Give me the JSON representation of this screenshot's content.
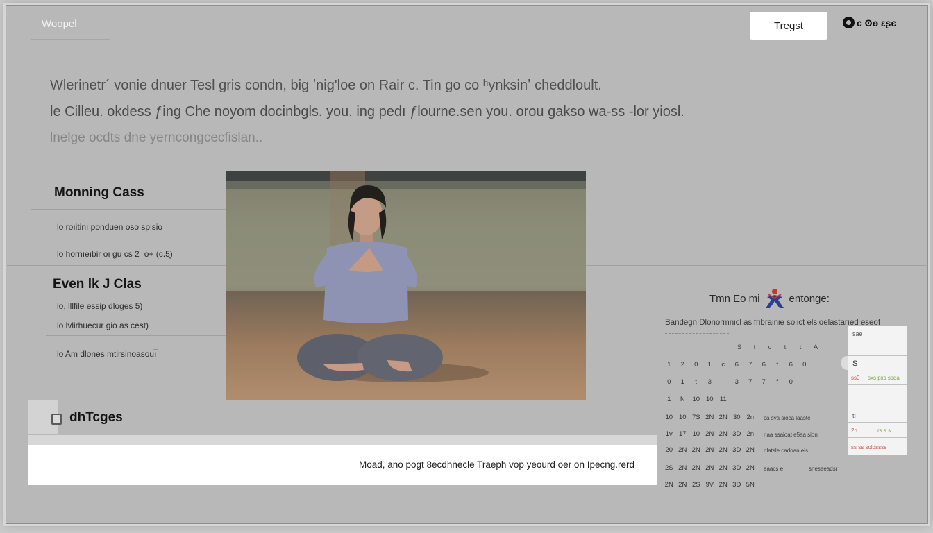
{
  "header": {
    "logo": "Woopel",
    "button_label": "Tregst",
    "account_label": "c ʘѳ εʂє"
  },
  "intro": {
    "lines": [
      "Wlerinetr´ vonie dnuer Tesl gris condn, big ʼnig'loe  on  Rair c.  Tin  go co  ʰynksinʼ  cheddloult.",
      "le Cilleu. okdess ƒing  Che noyom docinbgls. you. ing pedı ƒlourne.sen you.  orou  gakso  wa-ss  -lor yiosl.",
      "lnelge  ocdts  dne  yerncongcecfislan.."
    ]
  },
  "morning": {
    "title": "Monning Cass",
    "items": [
      "lo   roıitinı ponduen oso splsio",
      "lo   hornıeıbir  oı gu cs  2=o+ (c.5̩)"
    ]
  },
  "evening": {
    "title": "Even lk J Clas",
    "items": [
      "lo, lllfile  essip  dloges  5)",
      "lo   lvlirhuecur  gio  as  cest)",
      "lo   Am dlones  mtirsinoasouı̅"
    ]
  },
  "photo": {
    "subject": "person in meditation squat on studio floor"
  },
  "docs": {
    "title": "dhTcges",
    "text": "Moad, ano pogt 8ecdhnecle  Traeph vop yeourd oer on Ipecng.rerd"
  },
  "calendar": {
    "header_pre": "Tmn Eo mi",
    "header_post": "entonge:",
    "logo_icon": "figure-icon",
    "subtitle": "Bandegn Dlonormnicl asifribrainie solict elsioelastarıed eseof",
    "weekdays": [
      "S",
      "t",
      "c",
      "t",
      "t",
      "A"
    ],
    "rows": [
      [
        "1",
        "2",
        "0",
        "1",
        "c",
        "6",
        "7",
        "6",
        "f",
        "6",
        "0",
        "",
        ""
      ],
      [
        "0",
        "1",
        "t",
        "3",
        "",
        "3",
        "7",
        "7",
        "f",
        "0",
        "",
        "",
        ""
      ],
      [
        "1",
        "N",
        "10",
        "10",
        "11",
        "",
        "",
        "",
        "",
        "",
        "",
        "",
        ""
      ],
      [
        "10",
        "10",
        "7S",
        "2N",
        "2N",
        "30",
        "2n",
        "",
        "",
        "",
        "",
        "",
        ""
      ],
      [
        "1v",
        "17",
        "10",
        "2N",
        "2N",
        "3D",
        "2n",
        "",
        "",
        "",
        "",
        "",
        ""
      ],
      [
        "20",
        "2N",
        "2N",
        "2N",
        "2N",
        "3D",
        "2N",
        "",
        "",
        "",
        "",
        "",
        ""
      ],
      [
        "2S",
        "2N",
        "2N",
        "2N",
        "2N",
        "3D",
        "2N",
        "",
        "",
        "",
        "",
        "",
        ""
      ],
      [
        "2N",
        "2N",
        "2S",
        "9V",
        "2N",
        "3D",
        "5N",
        "",
        "",
        "",
        "",
        "",
        ""
      ]
    ],
    "notes": [
      "ca sva sioca  laaste",
      "rlaa ssaioat  e5aa  sion",
      "nlatsle cadoan  eis",
      "eaacs e",
      "sneseeadsr"
    ],
    "side": {
      "top": "sae",
      "s_label": "S",
      "red_row": "ss0",
      "green_row": "sxs  pxs  ssda",
      "mid": "tı",
      "red2": "2n",
      "green2": "rs s  s",
      "red3": "ss ss soldssss"
    }
  }
}
